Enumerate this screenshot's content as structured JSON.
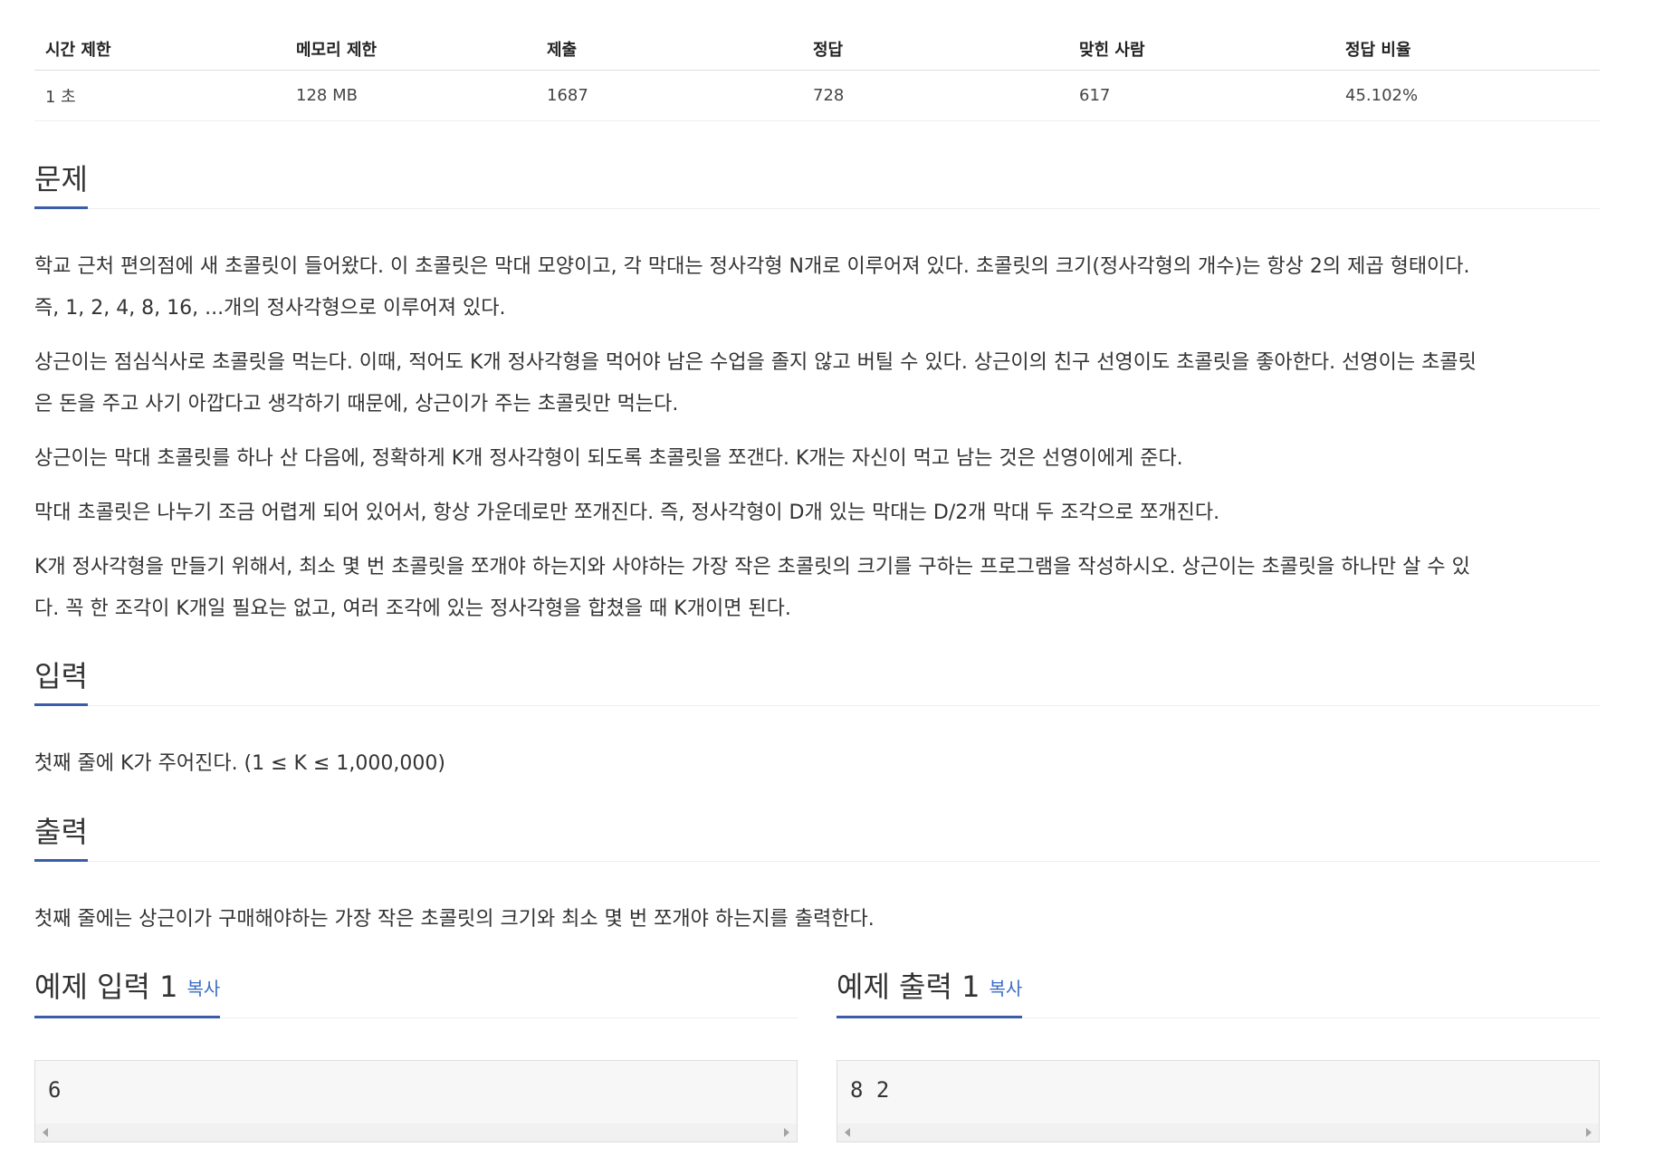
{
  "info_table": {
    "headers": [
      "시간 제한",
      "메모리 제한",
      "제출",
      "정답",
      "맞힌 사람",
      "정답 비율"
    ],
    "values": [
      "1 초",
      "128 MB",
      "1687",
      "728",
      "617",
      "45.102%"
    ]
  },
  "problem": {
    "title": "문제",
    "paragraphs": [
      [
        "학교 근처 편의점에 새 초콜릿이 들어왔다. 이 초콜릿은 막대 모양이고, 각 막대는 정사각형 N개로 이루어져 있다. 초콜릿의 크기(정사각형의 개수)는 항상 2의 제곱 형태이다.",
        "즉, 1, 2, 4, 8, 16, ...개의 정사각형으로 이루어져 있다."
      ],
      [
        "상근이는 점심식사로 초콜릿을 먹는다. 이때, 적어도 K개 정사각형을 먹어야 남은 수업을 졸지 않고 버틸 수 있다. 상근이의 친구 선영이도 초콜릿을 좋아한다. 선영이는 초콜릿",
        "은 돈을 주고 사기 아깝다고 생각하기 때문에, 상근이가 주는 초콜릿만 먹는다."
      ],
      [
        "상근이는 막대 초콜릿를 하나 산 다음에, 정확하게 K개 정사각형이 되도록 초콜릿을 쪼갠다. K개는 자신이 먹고 남는 것은 선영이에게 준다."
      ],
      [
        "막대 초콜릿은 나누기 조금 어렵게 되어 있어서, 항상 가운데로만 쪼개진다. 즉, 정사각형이 D개 있는 막대는 D/2개 막대 두 조각으로 쪼개진다."
      ],
      [
        "K개 정사각형을 만들기 위해서, 최소 몇 번 초콜릿을 쪼개야 하는지와 사야하는 가장 작은 초콜릿의 크기를 구하는 프로그램을 작성하시오. 상근이는 초콜릿을 하나만 살 수 있",
        "다. 꼭 한 조각이 K개일 필요는 없고, 여러 조각에 있는 정사각형을 합쳤을 때 K개이면 된다."
      ]
    ]
  },
  "input": {
    "title": "입력",
    "text": "첫째 줄에 K가 주어진다. (1 ≤ K ≤ 1,000,000)"
  },
  "output": {
    "title": "출력",
    "text": "첫째 줄에는 상근이가 구매해야하는 가장 작은 초콜릿의 크기와 최소 몇 번 쪼개야 하는지를 출력한다."
  },
  "sample_input": {
    "title": "예제 입력 1",
    "copy_label": "복사",
    "content": "6"
  },
  "sample_output": {
    "title": "예제 출력 1",
    "copy_label": "복사",
    "content": "8 2"
  }
}
